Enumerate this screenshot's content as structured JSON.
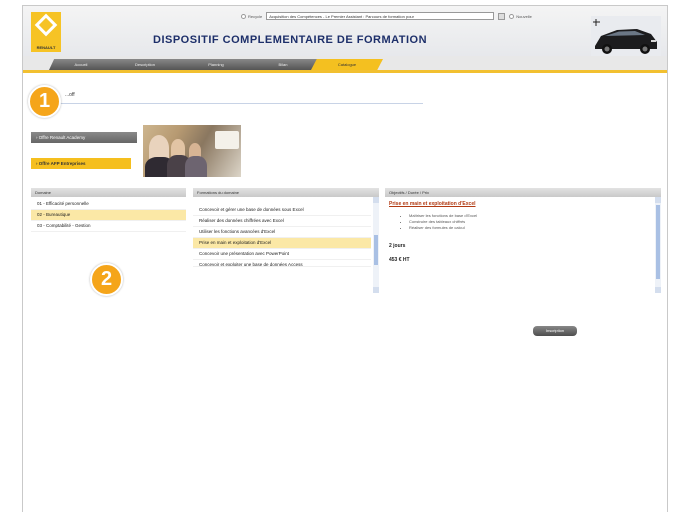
{
  "header": {
    "title": "DISPOSITIF COMPLEMENTAIRE DE FORMATION",
    "brand": "RENAULT",
    "radio_labels": [
      "Recycle",
      "Nouvelle"
    ],
    "search_value": "Acquisition des Compétences - Le Premier Assistant : Parcours de formation pour",
    "search_placeholder": ""
  },
  "tabs": [
    {
      "label": "Accueil"
    },
    {
      "label": "Description"
    },
    {
      "label": "Planning"
    },
    {
      "label": "Bilan"
    },
    {
      "label": "Catalogue"
    }
  ],
  "content": {
    "section_title": "...off"
  },
  "badges": [
    "1",
    "2"
  ],
  "offers": {
    "academy": "› Offre Renault Academy",
    "entreprise": "› Offre AFP Entreprises"
  },
  "domains": {
    "header": "Domaine",
    "items": [
      {
        "label": "01 - Efficacité personnelle",
        "selected": false
      },
      {
        "label": "02 - Bureautique",
        "selected": true
      },
      {
        "label": "03 - Comptabilité - Gestion",
        "selected": false
      }
    ]
  },
  "formations": {
    "header": "Formations du domaine",
    "items": [
      {
        "label": "Concevoir et gérer une base de données sous Excel",
        "selected": false
      },
      {
        "label": "Réaliser des données chiffrées avec Excel",
        "selected": false
      },
      {
        "label": "Utiliser les fonctions avancées d'Excel",
        "selected": false
      },
      {
        "label": "Prise en main et exploitation d'Excel",
        "selected": true
      },
      {
        "label": "Concevoir une présentation avec PowerPoint",
        "selected": false
      },
      {
        "label": "Concevoir et exploiter une base de données Access",
        "selected": false
      }
    ]
  },
  "objectives": {
    "header": "Objectifs / Durée / Prix",
    "link": "Prise en main et exploitation d'Excel",
    "bullets": [
      "Maîtriser les fonctions de base d'Excel",
      "Construire des tableaux chiffrés",
      "Réaliser des formules de calcul"
    ],
    "duration": "2 jours",
    "price": "453 € HT"
  },
  "action": {
    "label": "Inscription"
  },
  "colors": {
    "accent": "#f2c030",
    "selection": "#fbe8a6",
    "badge": "#f5a51a",
    "title": "#1d2f6a"
  }
}
